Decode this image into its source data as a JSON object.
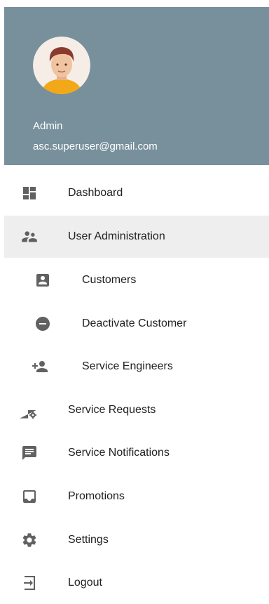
{
  "header": {
    "user_name": "Admin",
    "user_email": "asc.superuser@gmail.com",
    "background_color": "#78909c"
  },
  "menu": {
    "items": [
      {
        "label": "Dashboard",
        "icon": "dashboard-icon",
        "active": false
      },
      {
        "label": "User Administration",
        "icon": "supervisor-account-icon",
        "active": true
      },
      {
        "label": "Customers",
        "icon": "account-box-icon",
        "active": false
      },
      {
        "label": "Deactivate Customer",
        "icon": "remove-circle-icon",
        "active": false
      },
      {
        "label": "Service Engineers",
        "icon": "person-add-icon",
        "active": false
      },
      {
        "label": "Service Requests",
        "icon": "network-settings-icon",
        "active": false
      },
      {
        "label": "Service Notifications",
        "icon": "message-icon",
        "active": false
      },
      {
        "label": "Promotions",
        "icon": "inbox-icon",
        "active": false
      },
      {
        "label": "Settings",
        "icon": "gear-icon",
        "active": false
      },
      {
        "label": "Logout",
        "icon": "logout-icon",
        "active": false
      }
    ]
  }
}
